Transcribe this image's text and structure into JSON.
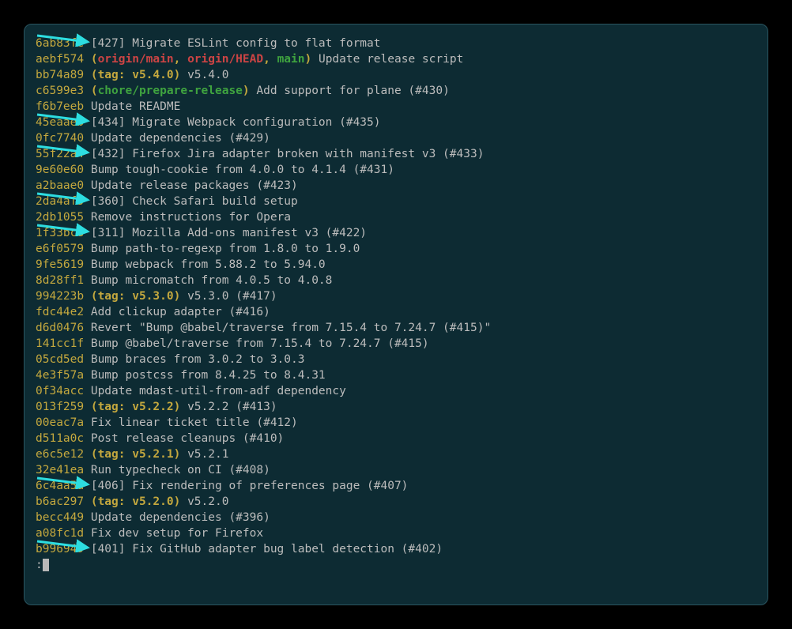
{
  "prompt": ":",
  "commits": [
    {
      "hash": "6ab83fe",
      "refs": [],
      "msg": "[427] Migrate ESLint config to flat format",
      "arrow": true
    },
    {
      "hash": "aebf574",
      "refs": [
        {
          "t": "remote",
          "v": "origin/main"
        },
        {
          "t": "remote",
          "v": "origin/HEAD"
        },
        {
          "t": "local",
          "v": "main"
        }
      ],
      "msg": "Update release script"
    },
    {
      "hash": "bb74a89",
      "refs": [
        {
          "t": "tag",
          "v": "tag: v5.4.0"
        }
      ],
      "msg": "v5.4.0"
    },
    {
      "hash": "c6599e3",
      "refs": [
        {
          "t": "local",
          "v": "chore/prepare-release"
        }
      ],
      "msg": "Add support for plane (#430)"
    },
    {
      "hash": "f6b7eeb",
      "refs": [],
      "msg": "Update README"
    },
    {
      "hash": "45eaaeb",
      "refs": [],
      "msg": "[434] Migrate Webpack configuration (#435)",
      "arrow": true
    },
    {
      "hash": "0fc7740",
      "refs": [],
      "msg": "Update dependencies (#429)"
    },
    {
      "hash": "55f22a4",
      "refs": [],
      "msg": "[432] Firefox Jira adapter broken with manifest v3 (#433)",
      "arrow": true
    },
    {
      "hash": "9e60e60",
      "refs": [],
      "msg": "Bump tough-cookie from 4.0.0 to 4.1.4 (#431)"
    },
    {
      "hash": "a2baae0",
      "refs": [],
      "msg": "Update release packages (#423)"
    },
    {
      "hash": "2da4af5",
      "refs": [],
      "msg": "[360] Check Safari build setup",
      "arrow": true
    },
    {
      "hash": "2db1055",
      "refs": [],
      "msg": "Remove instructions for Opera"
    },
    {
      "hash": "1f33bc8",
      "refs": [],
      "msg": "[311] Mozilla Add-ons manifest v3 (#422)",
      "arrow": true
    },
    {
      "hash": "e6f0579",
      "refs": [],
      "msg": "Bump path-to-regexp from 1.8.0 to 1.9.0"
    },
    {
      "hash": "9fe5619",
      "refs": [],
      "msg": "Bump webpack from 5.88.2 to 5.94.0"
    },
    {
      "hash": "8d28ff1",
      "refs": [],
      "msg": "Bump micromatch from 4.0.5 to 4.0.8"
    },
    {
      "hash": "994223b",
      "refs": [
        {
          "t": "tag",
          "v": "tag: v5.3.0"
        }
      ],
      "msg": "v5.3.0 (#417)"
    },
    {
      "hash": "fdc44e2",
      "refs": [],
      "msg": "Add clickup adapter (#416)"
    },
    {
      "hash": "d6d0476",
      "refs": [],
      "msg": "Revert \"Bump @babel/traverse from 7.15.4 to 7.24.7 (#415)\""
    },
    {
      "hash": "141cc1f",
      "refs": [],
      "msg": "Bump @babel/traverse from 7.15.4 to 7.24.7 (#415)"
    },
    {
      "hash": "05cd5ed",
      "refs": [],
      "msg": "Bump braces from 3.0.2 to 3.0.3"
    },
    {
      "hash": "4e3f57a",
      "refs": [],
      "msg": "Bump postcss from 8.4.25 to 8.4.31"
    },
    {
      "hash": "0f34acc",
      "refs": [],
      "msg": "Update mdast-util-from-adf dependency"
    },
    {
      "hash": "013f259",
      "refs": [
        {
          "t": "tag",
          "v": "tag: v5.2.2"
        }
      ],
      "msg": "v5.2.2 (#413)"
    },
    {
      "hash": "00eac7a",
      "refs": [],
      "msg": "Fix linear ticket title (#412)"
    },
    {
      "hash": "d511a0c",
      "refs": [],
      "msg": "Post release cleanups (#410)"
    },
    {
      "hash": "e6c5e12",
      "refs": [
        {
          "t": "tag",
          "v": "tag: v5.2.1"
        }
      ],
      "msg": "v5.2.1"
    },
    {
      "hash": "32e41ea",
      "refs": [],
      "msg": "Run typecheck on CI (#408)"
    },
    {
      "hash": "6c4aa5a",
      "refs": [],
      "msg": "[406] Fix rendering of preferences page (#407)",
      "arrow": true
    },
    {
      "hash": "b6ac297",
      "refs": [
        {
          "t": "tag",
          "v": "tag: v5.2.0"
        }
      ],
      "msg": "v5.2.0"
    },
    {
      "hash": "becc449",
      "refs": [],
      "msg": "Update dependencies (#396)"
    },
    {
      "hash": "a08fc1d",
      "refs": [],
      "msg": "Fix dev setup for Firefox"
    },
    {
      "hash": "b996949",
      "refs": [],
      "msg": "[401] Fix GitHub adapter bug label detection (#402)",
      "arrow": true
    }
  ]
}
